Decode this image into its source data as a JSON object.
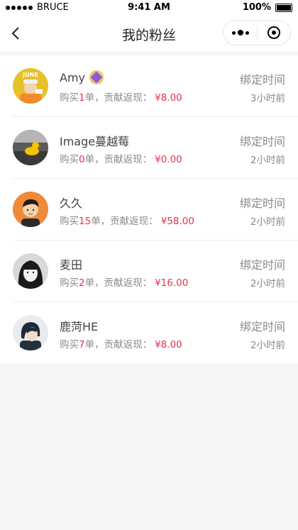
{
  "status_bar": {
    "carrier": "BRUCE",
    "time": "9:41 AM",
    "battery": "100%"
  },
  "nav": {
    "title": "我的粉丝"
  },
  "fans": [
    {
      "name": "Amy",
      "purchase_prefix": "购买",
      "count": "1",
      "purchase_suffix": "单，贡献返现：",
      "cashback": "¥8.00",
      "bind_label": "绑定时间",
      "bind_time": "3小时前",
      "has_badge": true
    },
    {
      "name": "Image蔓越莓",
      "purchase_prefix": "购买",
      "count": "0",
      "purchase_suffix": "单，贡献返现：",
      "cashback": "¥0.00",
      "bind_label": "绑定时间",
      "bind_time": "2小时前",
      "has_badge": false
    },
    {
      "name": "久久",
      "purchase_prefix": "购买",
      "count": "15",
      "purchase_suffix": "单，贡献返现：",
      "cashback": "¥58.00",
      "bind_label": "绑定时间",
      "bind_time": "2小时前",
      "has_badge": false
    },
    {
      "name": "麦田",
      "purchase_prefix": "购买",
      "count": "2",
      "purchase_suffix": "单，贡献返现：",
      "cashback": "¥16.00",
      "bind_label": "绑定时间",
      "bind_time": "2小时前",
      "has_badge": false
    },
    {
      "name": "鹿菏HE",
      "purchase_prefix": "购买",
      "count": "7",
      "purchase_suffix": "单，贡献返现：",
      "cashback": "¥8.00",
      "bind_label": "绑定时间",
      "bind_time": "2小时前",
      "has_badge": false
    }
  ],
  "avatar_1_logo": "JUNE",
  "colors": {
    "accent": "#e8314a",
    "muted": "#8a8a8a",
    "background": "#f5f6f5"
  }
}
